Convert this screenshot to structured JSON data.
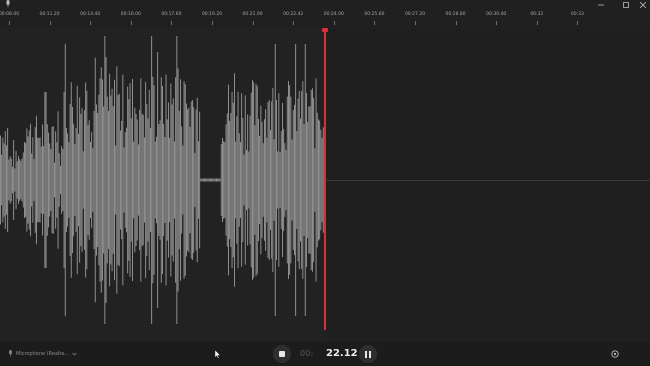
{
  "window": {
    "icon": "microphone-icon",
    "controls": [
      "minimize-icon",
      "maximize-icon",
      "close-icon"
    ]
  },
  "timeline": {
    "ticks": [
      "00:08.00",
      "00:11.20",
      "00:14.40",
      "00:16.00",
      "00:17.60",
      "00:19.20",
      "00:21.00",
      "00:22.42",
      "00:24.00",
      "00:25.60",
      "00:27.20",
      "00:28.80",
      "00:30.40",
      "00:32",
      "00:33"
    ]
  },
  "recording": {
    "elapsed_dim": "00:",
    "elapsed": "22.12",
    "playhead_color": "#d8303a",
    "waveform_color": "#9a9a9a"
  },
  "bottombar": {
    "mic_label": "Microphone (Realte...",
    "mic_chevron": "chevron-down-icon",
    "stop_icon": "stop-icon",
    "pause_icon": "pause-icon",
    "settings_icon": "gear-icon"
  }
}
